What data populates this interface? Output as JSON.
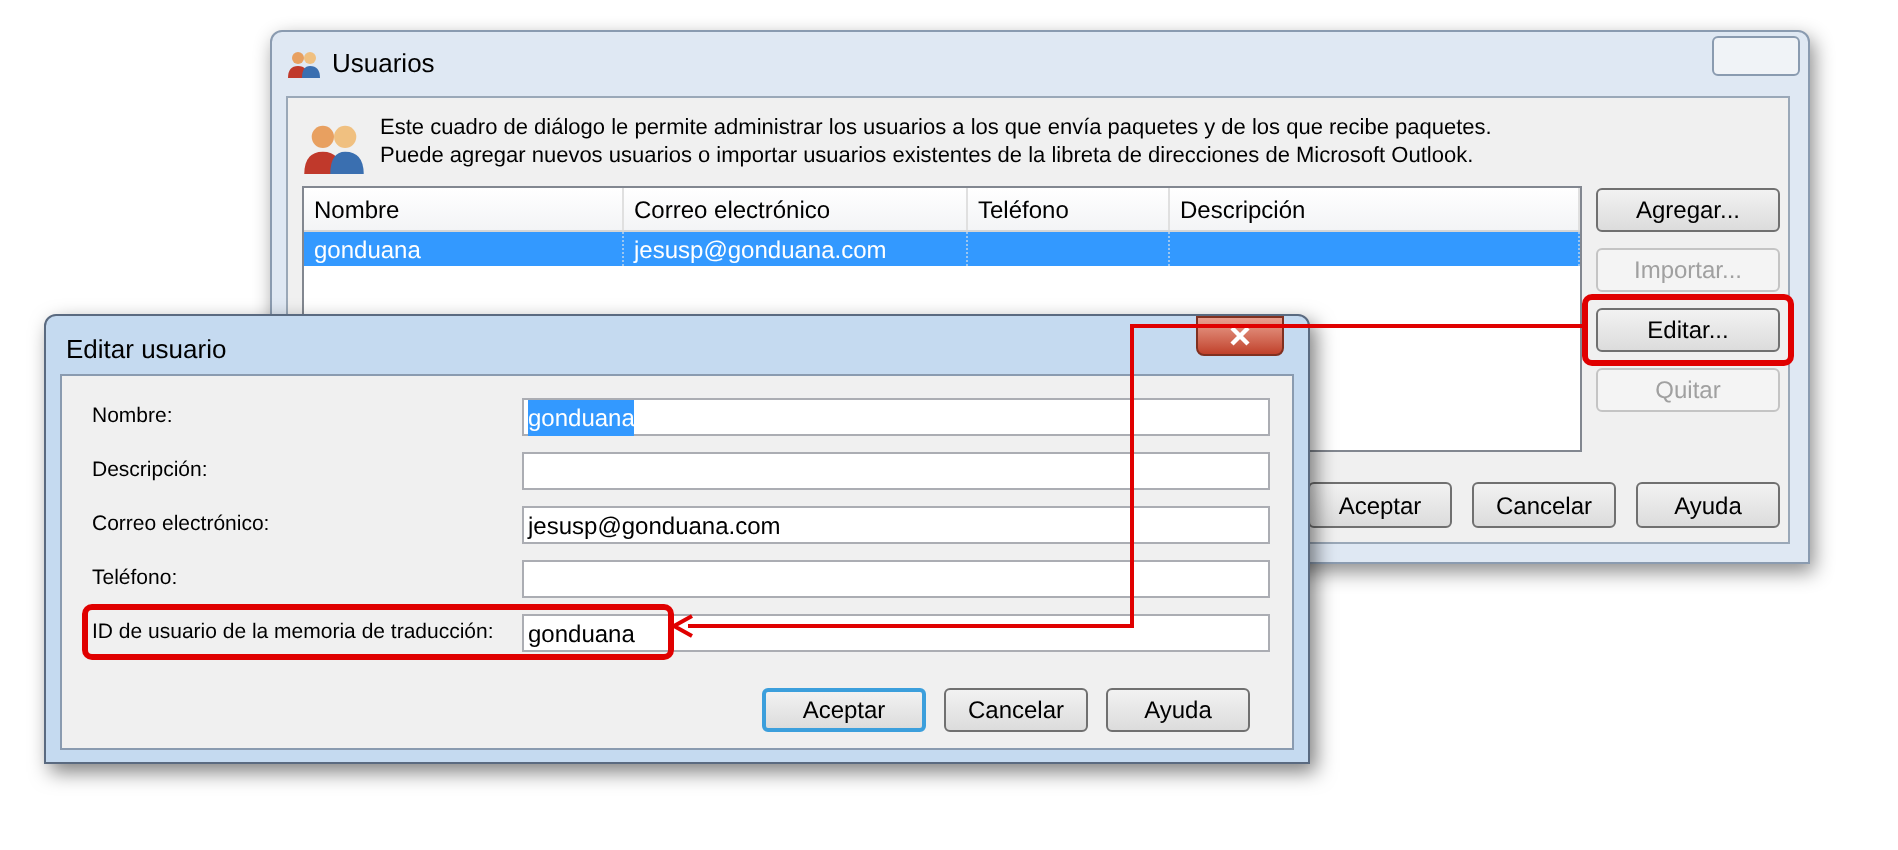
{
  "users_dialog": {
    "title": "Usuarios",
    "description": "Este cuadro de diálogo le permite administrar los usuarios a los que envía paquetes y de los que recibe paquetes. Puede agregar nuevos usuarios o importar usuarios existentes de la libreta de direcciones de Microsoft Outlook.",
    "table": {
      "columns": [
        "Nombre",
        "Correo electrónico",
        "Teléfono",
        "Descripción"
      ],
      "rows": [
        {
          "cells": [
            "gonduana",
            "jesusp@gonduana.com",
            "",
            ""
          ],
          "selected": true
        }
      ]
    },
    "side_buttons": [
      {
        "label": "Agregar...",
        "disabled": false,
        "annotated": false
      },
      {
        "label": "Importar...",
        "disabled": true,
        "annotated": false
      },
      {
        "label": "Editar...",
        "disabled": false,
        "annotated": true
      },
      {
        "label": "Quitar",
        "disabled": true,
        "annotated": false
      }
    ],
    "buttons": [
      "Aceptar",
      "Cancelar",
      "Ayuda"
    ]
  },
  "edit_dialog": {
    "title": "Editar usuario",
    "fields": [
      {
        "label": "Nombre:",
        "value": "gonduana",
        "text_selected": true,
        "annotated": false
      },
      {
        "label": "Descripción:",
        "annotated": false
      },
      {
        "label": "Correo electrónico:",
        "value": "jesusp@gonduana.com",
        "text_selected": false,
        "annotated": false
      },
      {
        "label": "Teléfono:",
        "annotated": false
      },
      {
        "label": "ID de usuario de la memoria de traducción:",
        "value": "gonduana",
        "text_selected": false,
        "annotated": true
      }
    ],
    "buttons": [
      {
        "label": "Aceptar",
        "default": true
      },
      {
        "label": "Cancelar",
        "default": false
      },
      {
        "label": "Ayuda",
        "default": false
      }
    ]
  }
}
